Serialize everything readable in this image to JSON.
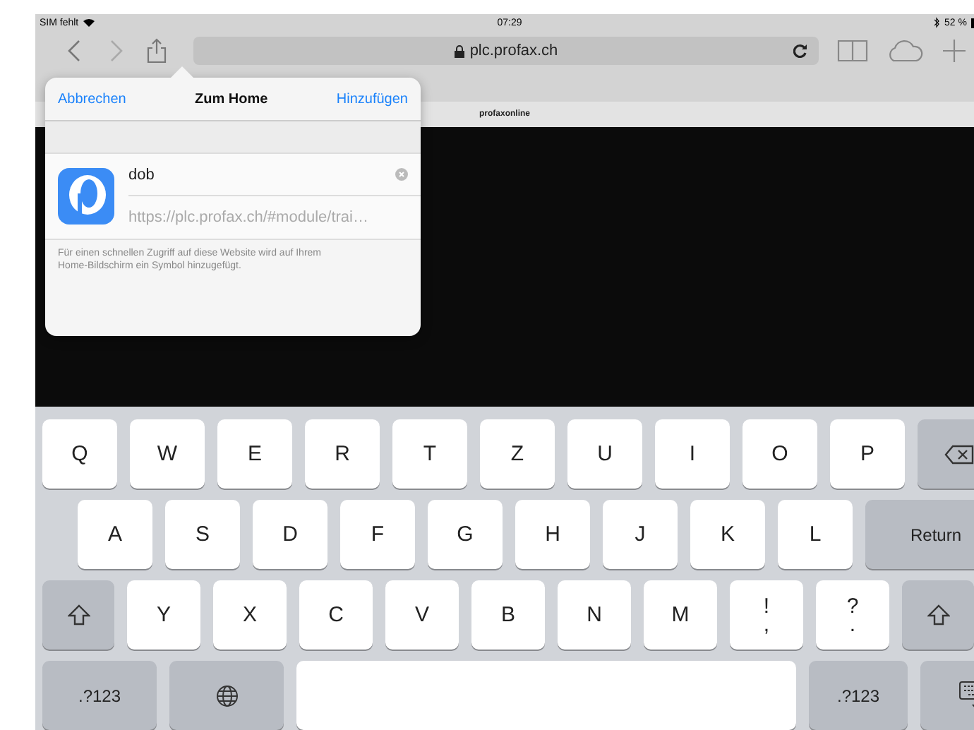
{
  "status_bar": {
    "carrier": "SIM fehlt",
    "time": "07:29",
    "battery": "52 %"
  },
  "toolbar": {
    "back_disabled": false,
    "forward_disabled": true,
    "url": "plc.profax.ch"
  },
  "page": {
    "title": "profaxonline"
  },
  "popover": {
    "cancel": "Abbrechen",
    "title": "Zum Home",
    "add": "Hinzufügen",
    "name_value": "dob",
    "url": "https://plc.profax.ch/#module/trai…",
    "note": "Für einen schnellen Zugriff auf diese Website wird auf Ihrem Home-Bildschirm ein Symbol hinzugefügt."
  },
  "keyboard": {
    "rows": [
      {
        "keys": [
          {
            "kind": "letter",
            "label": "Q"
          },
          {
            "kind": "letter",
            "label": "W"
          },
          {
            "kind": "letter",
            "label": "E"
          },
          {
            "kind": "letter",
            "label": "R"
          },
          {
            "kind": "letter",
            "label": "T"
          },
          {
            "kind": "letter",
            "label": "Z"
          },
          {
            "kind": "letter",
            "label": "U"
          },
          {
            "kind": "letter",
            "label": "I"
          },
          {
            "kind": "letter",
            "label": "O"
          },
          {
            "kind": "letter",
            "label": "P"
          },
          {
            "kind": "backspace"
          }
        ]
      },
      {
        "keys": [
          {
            "kind": "letter",
            "label": "A"
          },
          {
            "kind": "letter",
            "label": "S"
          },
          {
            "kind": "letter",
            "label": "D"
          },
          {
            "kind": "letter",
            "label": "F"
          },
          {
            "kind": "letter",
            "label": "G"
          },
          {
            "kind": "letter",
            "label": "H"
          },
          {
            "kind": "letter",
            "label": "J"
          },
          {
            "kind": "letter",
            "label": "K"
          },
          {
            "kind": "letter",
            "label": "L"
          },
          {
            "kind": "return",
            "label": "Return"
          }
        ]
      },
      {
        "keys": [
          {
            "kind": "shift"
          },
          {
            "kind": "letter",
            "label": "Y"
          },
          {
            "kind": "letter",
            "label": "X"
          },
          {
            "kind": "letter",
            "label": "C"
          },
          {
            "kind": "letter",
            "label": "V"
          },
          {
            "kind": "letter",
            "label": "B"
          },
          {
            "kind": "letter",
            "label": "N"
          },
          {
            "kind": "letter",
            "label": "M"
          },
          {
            "kind": "punct",
            "label": "!",
            "sub": ","
          },
          {
            "kind": "punct",
            "label": "?",
            "sub": "."
          },
          {
            "kind": "shift"
          }
        ]
      },
      {
        "keys": [
          {
            "kind": "numbers",
            "label": ".?123"
          },
          {
            "kind": "globe"
          },
          {
            "kind": "space"
          },
          {
            "kind": "numbers_right",
            "label": ".?123"
          },
          {
            "kind": "hide"
          }
        ]
      }
    ]
  }
}
